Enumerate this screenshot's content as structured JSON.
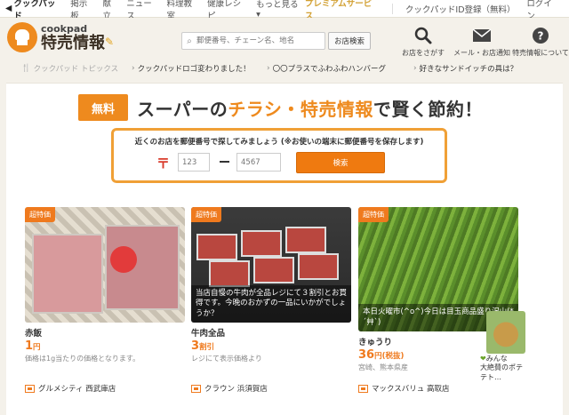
{
  "topnav": {
    "back_label": "クックパッド",
    "links": [
      "掲示板",
      "献立",
      "ニュース",
      "料理教室",
      "健康レシピ",
      "もっと見る ▾"
    ],
    "premium": "プレミアムサービス",
    "register": "クックパッドID登録（無料）",
    "login": "ログイン"
  },
  "header": {
    "logo_small": "cookpad",
    "logo_main": "特売情報",
    "search_placeholder": "郵便番号、チェーン名、地名",
    "search_button": "お店検索",
    "icons": [
      {
        "name": "search-icon",
        "label": "お店をさがす"
      },
      {
        "name": "mail-icon",
        "label": "メール・お店通知"
      },
      {
        "name": "help-icon",
        "label": "特売情報について"
      }
    ]
  },
  "topics": {
    "head": "クックパッド トピックス",
    "items": [
      "クックパッドロゴ変わりました！",
      "〇〇プラスでふわふわハンバーグ",
      "好きなサンドイッチの具は？"
    ]
  },
  "hero": {
    "badge": "無料",
    "title_a": "スーパーの",
    "title_hl": "チラシ・特売情報",
    "title_b": "で賢く節約！"
  },
  "zip": {
    "label": "近くのお店を郵便番号で探してみましょう (※お使いの端末に郵便番号を保存します)",
    "mark": "〒",
    "first_placeholder": "123",
    "second_placeholder": "4567",
    "button": "検索"
  },
  "cards": [
    {
      "badge": "超特価",
      "overlay": "",
      "name": "赤飯",
      "price": "1",
      "price_unit": "円",
      "note": "価格は1g当たりの価格となります。",
      "store": "グルメシティ 西武庫店"
    },
    {
      "badge": "超特価",
      "overlay": "当店自慢の牛肉が全品レジにて３割引とお買得です。今晩のおかずの一品にいかがでしょうか？",
      "name": "牛肉全品",
      "price": "3",
      "price_unit": "割引",
      "note": "レジにて表示価格より",
      "store": "クラウン 浜須賀店"
    },
    {
      "badge": "超特価",
      "overlay": "本日火曜市(^o^)今日は目玉商品盛り沢山(*´艸`)",
      "name": "きゅうり",
      "price": "36",
      "price_unit": "円(税抜)",
      "note": "宮崎、熊本県産",
      "store": "マックスバリュ 高取店"
    }
  ],
  "side": {
    "line1": "みんな",
    "line2": "大絶賛のポテ",
    "line3": "テト…"
  }
}
